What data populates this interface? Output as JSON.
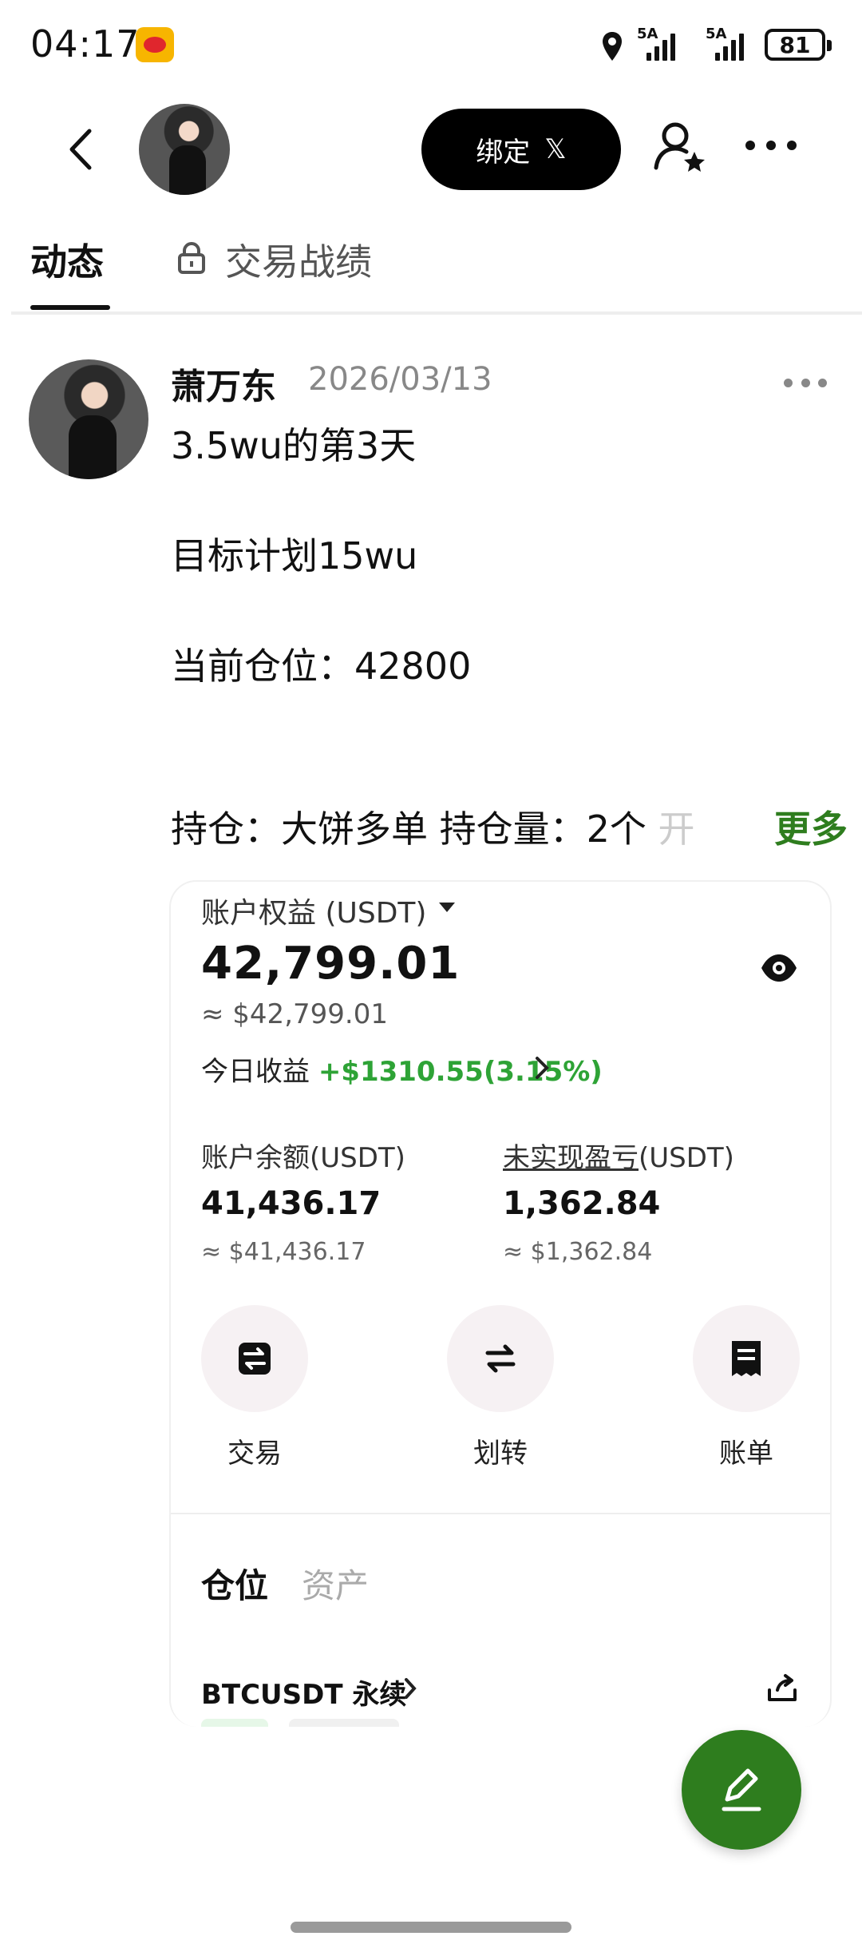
{
  "status_bar": {
    "time": "04:17",
    "signal1_label": "5A",
    "signal2_label": "5A",
    "battery": "81"
  },
  "header": {
    "bind_label": "绑定",
    "bind_icon": "𝕏"
  },
  "tabs": [
    {
      "label": "动态"
    },
    {
      "label": "交易战绩"
    }
  ],
  "post": {
    "author": "萧万东",
    "date": "2026/03/13",
    "lines": [
      "3.5wu的第3天",
      "目标计划15wu",
      "当前仓位：42800"
    ],
    "holding": "持仓：大饼多单  持仓量：2个",
    "holding_faded": "开",
    "more_label": "更多"
  },
  "card": {
    "title": "账户权益 (USDT)",
    "equity": "42,799.01",
    "equity_usd": "≈ $42,799.01",
    "today_label": "今日收益",
    "today_pl": "+$1310.55(3.15%)",
    "balance_label": "账户余额(USDT)",
    "balance_value": "41,436.17",
    "balance_usd": "≈ $41,436.17",
    "unrealized_label_u": "未实现盈亏",
    "unrealized_label_rest": "(USDT)",
    "unrealized_value": "1,362.84",
    "unrealized_usd": "≈ $1,362.84",
    "actions": [
      {
        "label": "交易"
      },
      {
        "label": "划转"
      },
      {
        "label": "账单"
      }
    ],
    "tab_positions": "仓位",
    "tab_assets": "资产",
    "pair": "BTCUSDT 永续"
  },
  "colors": {
    "accent_green": "#2e7d1e",
    "profit_green": "#2ea336"
  }
}
